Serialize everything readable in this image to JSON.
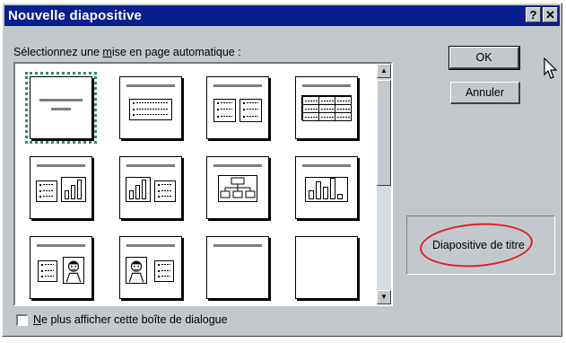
{
  "dialog": {
    "title": "Nouvelle diapositive",
    "help_glyph": "?",
    "close_glyph": "✕"
  },
  "layout_section": {
    "instruction_before": "Sélectionnez une ",
    "instruction_mnemonic": "m",
    "instruction_after": "ise en page automatique :",
    "thumbnails": [
      {
        "name": "Diapositive de titre",
        "kind": "title"
      },
      {
        "name": "Liste à puces",
        "kind": "bullets"
      },
      {
        "name": "Texte sur 2 colonnes",
        "kind": "two-columns"
      },
      {
        "name": "Tableau",
        "kind": "table"
      },
      {
        "name": "Texte et graphique",
        "kind": "text-chart"
      },
      {
        "name": "Graphique et texte",
        "kind": "chart-text"
      },
      {
        "name": "Organigramme",
        "kind": "org-chart"
      },
      {
        "name": "Graphique",
        "kind": "chart"
      },
      {
        "name": "Texte et image",
        "kind": "text-clipart"
      },
      {
        "name": "Image et texte",
        "kind": "clipart-text"
      },
      {
        "name": "Titre seul",
        "kind": "title-only"
      },
      {
        "name": "Vide",
        "kind": "blank"
      }
    ],
    "selected_index": 0
  },
  "buttons": {
    "ok": "OK",
    "cancel": "Annuler"
  },
  "preview": {
    "label": "Diapositive de titre"
  },
  "checkbox": {
    "mnemonic": "N",
    "label_rest": "e plus afficher cette boîte de dialogue",
    "checked": false
  },
  "colors": {
    "titlebar": "#0a1f8e",
    "face": "#c3c8cd",
    "annotation_circle": "#d22222",
    "selection_outline": "#2a8a7a"
  }
}
